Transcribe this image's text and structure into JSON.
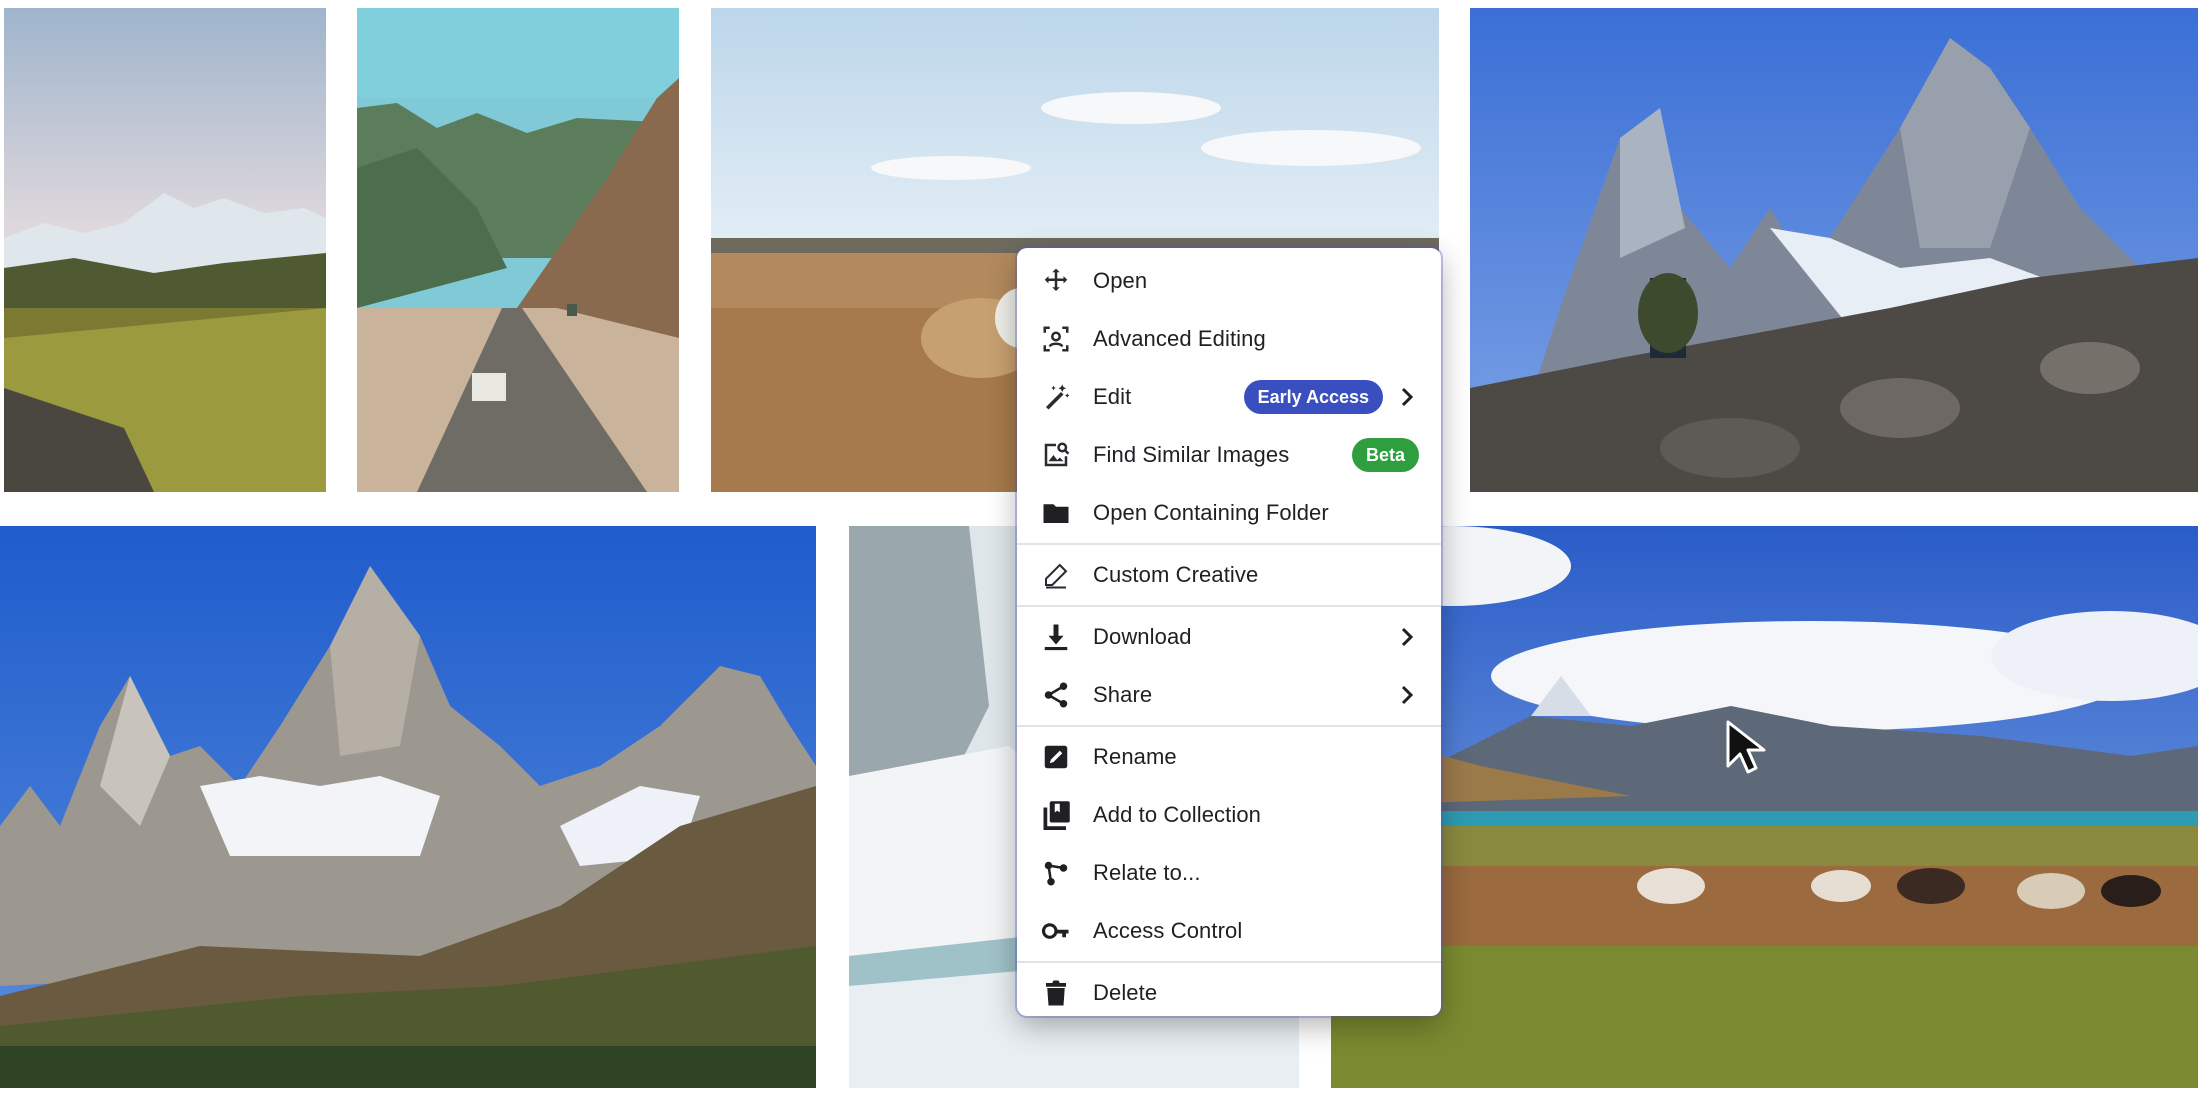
{
  "menu": {
    "items": [
      {
        "label": "Open",
        "icon": "move-arrows-icon"
      },
      {
        "label": "Advanced Editing",
        "icon": "face-scan-icon"
      },
      {
        "label": "Edit",
        "icon": "magic-wand-icon",
        "badge": "Early Access",
        "submenu": true
      },
      {
        "label": "Find Similar Images",
        "icon": "image-search-icon",
        "badge": "Beta"
      },
      {
        "label": "Open Containing Folder",
        "icon": "folder-icon"
      },
      {
        "label": "Custom Creative",
        "icon": "pencil-icon"
      },
      {
        "label": "Download",
        "icon": "download-icon",
        "submenu": true
      },
      {
        "label": "Share",
        "icon": "share-icon",
        "submenu": true
      },
      {
        "label": "Rename",
        "icon": "rename-icon"
      },
      {
        "label": "Add to Collection",
        "icon": "collection-icon"
      },
      {
        "label": "Relate to...",
        "icon": "relate-nodes-icon"
      },
      {
        "label": "Access Control",
        "icon": "key-icon"
      },
      {
        "label": "Delete",
        "icon": "trash-icon"
      }
    ]
  },
  "colors": {
    "early_access_badge": "#3a4fbf",
    "beta_badge": "#2e9e3e",
    "menu_text": "#1f1f24"
  },
  "gallery": {
    "tiles": [
      "mountain-meadow-photo",
      "desert-road-photo",
      "white-horse-steppe-photo",
      "hiker-mountain-photo",
      "fitz-roy-photo",
      "snowy-lake-photo",
      "wild-horses-lake-photo"
    ]
  }
}
